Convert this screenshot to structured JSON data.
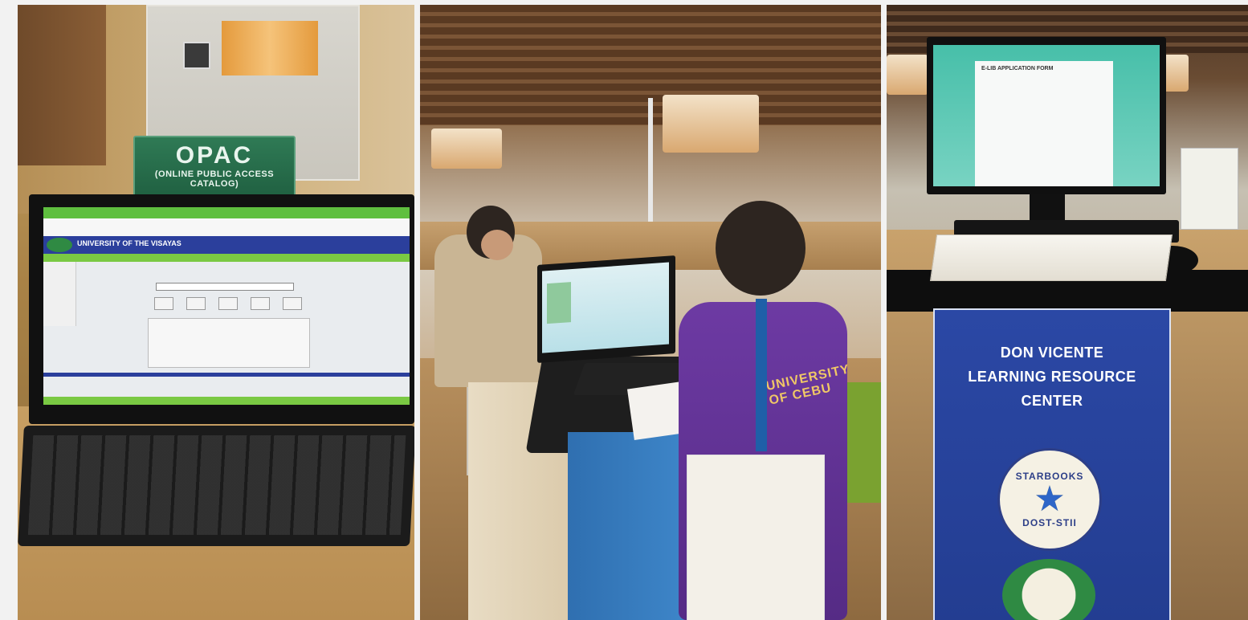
{
  "panels": {
    "opac": {
      "sign_title": "OPAC",
      "sign_subtitle": "(ONLINE PUBLIC ACCESS CATALOG)",
      "screen_header": "UNIVERSITY OF THE VISAYAS"
    },
    "students": {
      "shirt_text": "UNIVERSITY OF CEBU"
    },
    "starbooks": {
      "banner_lines": [
        "DON VICENTE",
        "LEARNING RESOURCE",
        "CENTER"
      ],
      "seal_top": "STARBOOKS",
      "seal_bottom": "DOST-STII",
      "screen_title": "E-LIB APPLICATION FORM"
    }
  },
  "colors": {
    "banner_blue": "#233d91",
    "opac_green": "#1f5f40",
    "screen_bar_blue": "#2b3f9c",
    "screen_green": "#5fbf3f",
    "shirt_purple": "#552b85"
  }
}
